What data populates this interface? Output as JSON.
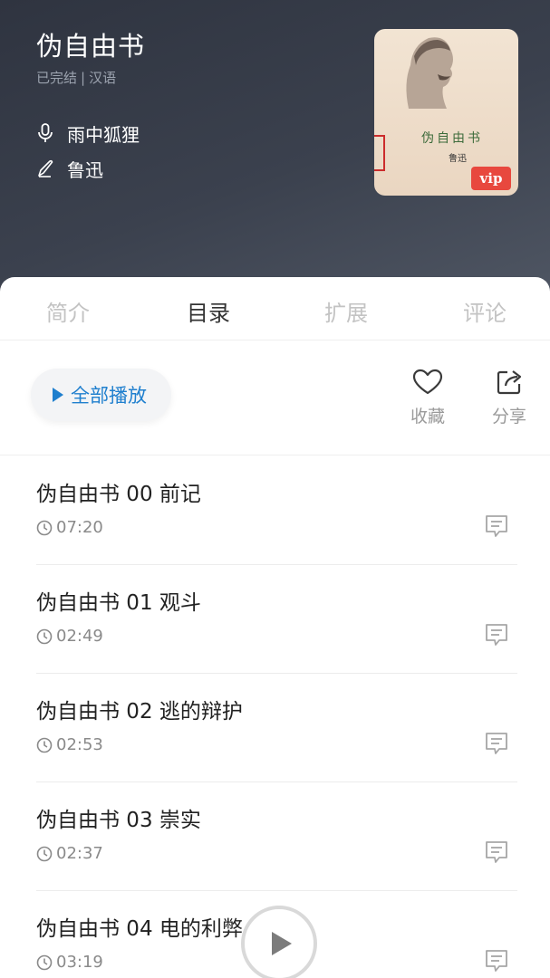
{
  "book": {
    "title": "伪自由书",
    "status": "已完结",
    "separator": "|",
    "language": "汉语",
    "narrator": "雨中狐狸",
    "author": "鲁迅",
    "cover": {
      "title": "伪自由书",
      "signature": "鲁迅",
      "badge": "vip"
    }
  },
  "tabs": [
    {
      "label": "简介",
      "active": false
    },
    {
      "label": "目录",
      "active": true
    },
    {
      "label": "扩展",
      "active": false
    },
    {
      "label": "评论",
      "active": false
    }
  ],
  "actions": {
    "play_all": "全部播放",
    "favorite": "收藏",
    "share": "分享"
  },
  "episodes": [
    {
      "title": "伪自由书 00 前记",
      "duration": "07:20"
    },
    {
      "title": "伪自由书 01 观斗",
      "duration": "02:49"
    },
    {
      "title": "伪自由书 02 逃的辩护",
      "duration": "02:53"
    },
    {
      "title": "伪自由书 03 崇实",
      "duration": "02:37"
    },
    {
      "title": "伪自由书 04 电的利弊",
      "duration": "03:19"
    }
  ],
  "icons": {
    "narrator": "microphone-icon",
    "author": "pen-icon",
    "favorite": "heart-icon",
    "share": "share-icon",
    "duration": "clock-icon",
    "comment": "comment-icon",
    "player": "play-icon"
  },
  "colors": {
    "accent": "#1f7fce",
    "vip": "#e8483e",
    "header_bg": "#353a46"
  }
}
